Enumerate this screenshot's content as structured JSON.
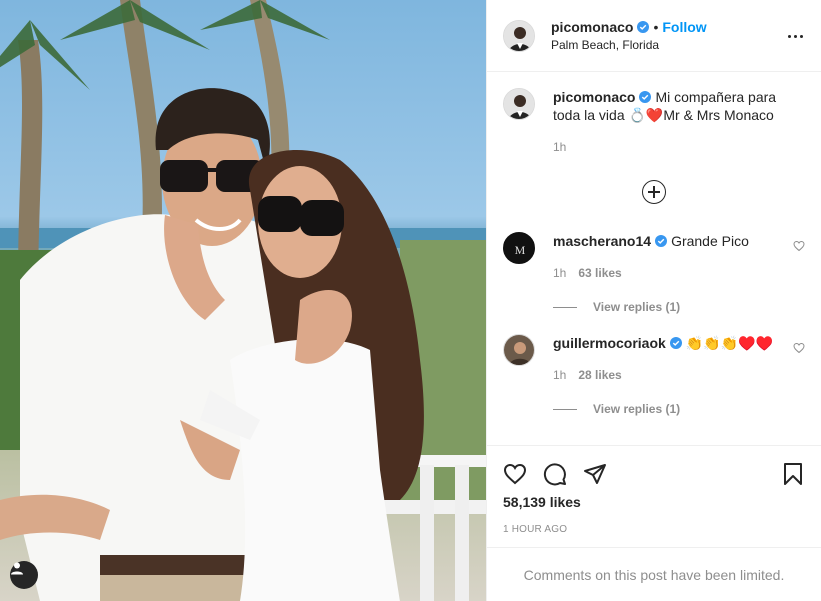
{
  "header": {
    "username": "picomonaco",
    "follow_label": "Follow",
    "separator": "•",
    "location": "Palm Beach, Florida"
  },
  "caption": {
    "username": "picomonaco",
    "text": "Mi compañera para toda la vida 💍❤️Mr & Mrs Monaco",
    "time": "1h"
  },
  "comments": [
    {
      "username": "mascherano14",
      "text": "Grande Pico",
      "time": "1h",
      "likes": "63 likes",
      "view_replies": "View replies (1)"
    },
    {
      "username": "guillermocoriaok",
      "text": "👏👏👏♥️♥️",
      "time": "1h",
      "likes": "28 likes",
      "view_replies": "View replies (1)"
    }
  ],
  "actions": {
    "icons": [
      "heart-icon",
      "comment-icon",
      "share-icon",
      "bookmark-icon"
    ],
    "likes": "58,139 likes",
    "time": "1 HOUR AGO"
  },
  "footer": {
    "limited_text": "Comments on this post have been limited."
  },
  "colors": {
    "link_blue": "#0095f6",
    "verified_blue": "#3897f0",
    "muted": "#8e8e8e",
    "text": "#262626"
  }
}
